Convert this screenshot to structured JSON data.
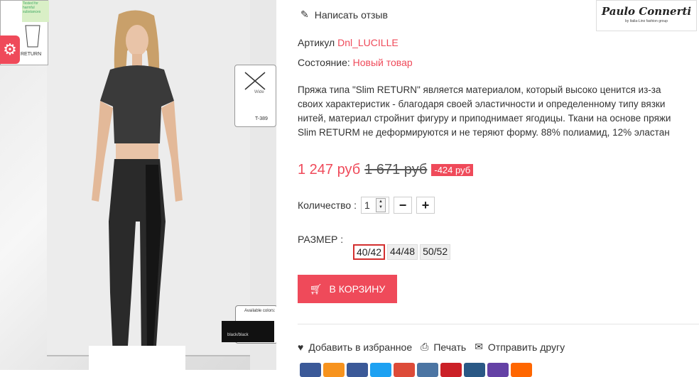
{
  "review": {
    "label": "Написать отзыв"
  },
  "logo": {
    "name": "Paulo Connerti",
    "tagline": "by Italia-Lino fashion group"
  },
  "article": {
    "label": "Артикул",
    "value": "Dnl_LUCILLE"
  },
  "condition": {
    "label": "Состояние:",
    "value": "Новый товар"
  },
  "description": "Пряжа типа \"Slim RETURN\" является материалом, который высоко ценится из-за своих характеристик - благодаря своей эластичности и определенному типу вязки нитей, материал стройнит фигуру и приподнимает ягодицы. Ткани на основе пряжи Slim RETURM не деформируются и не теряют форму. 88% полиамид, 12% эластан",
  "price": {
    "current": "1 247 руб",
    "old": "1 671 руб",
    "discount": "-424 руб"
  },
  "quantity": {
    "label": "Количество :",
    "value": "1"
  },
  "size": {
    "label": "РАЗМЕР :",
    "options": [
      "40/42",
      "44/48",
      "50/52"
    ],
    "selected": "40/42"
  },
  "cart": {
    "label": "В КОРЗИНУ"
  },
  "actions": {
    "favorite": "Добавить в избранное",
    "print": "Печать",
    "send": "Отправить другу"
  },
  "image_overlays": {
    "return_label": "RETURN",
    "tag_top": "Tested for harmful substances",
    "model_code": "T-389",
    "wide": "Wide",
    "available": "Available colors:",
    "color": "black/black"
  },
  "colors": {
    "accent": "#ef4a5a"
  },
  "social_colors": [
    "#3b5998",
    "#f7931e",
    "#3b5998",
    "#1da1f2",
    "#dd4b39",
    "#4c75a3",
    "#cb2027",
    "#2a5885",
    "#6441a5",
    "#ff6600"
  ]
}
